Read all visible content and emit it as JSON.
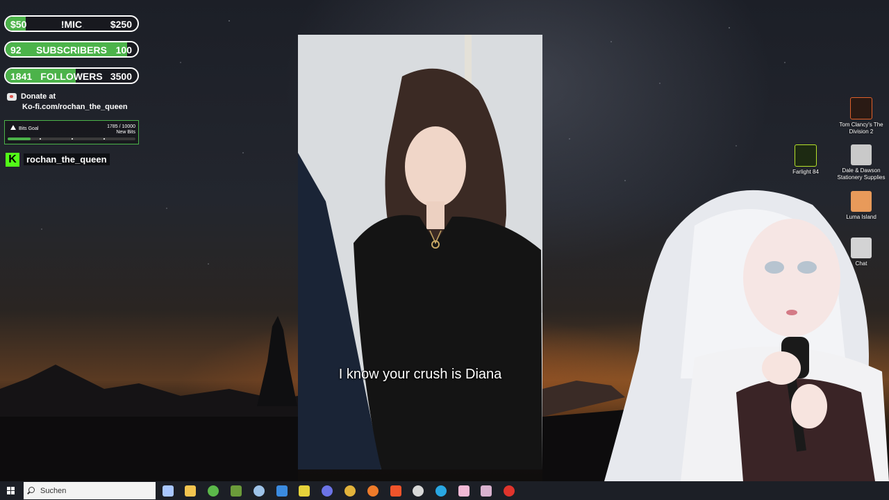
{
  "overlay": {
    "mic_goal": {
      "left": "$50",
      "center": "!MIC",
      "right": "$250",
      "progress": 0.15
    },
    "subscribers_goal": {
      "left": "92",
      "center": "SUBSCRIBERS",
      "right": "100",
      "progress": 0.92
    },
    "followers_goal": {
      "left": "1841",
      "center": "FOLLOWERS",
      "right": "3500",
      "progress": 0.53
    },
    "donate": {
      "line1": "Donate at",
      "line2": "Ko-fi.com/rochan_the_queen"
    },
    "bits_goal": {
      "title": "Bits Goal",
      "count": "1785 / 10000",
      "unit": "New Bits",
      "progress": 0.18
    },
    "kick": {
      "logo": "K",
      "username": "rochan_the_queen"
    }
  },
  "video": {
    "subtitle": "I know your crush is Diana"
  },
  "desktop_icons": [
    {
      "label": "Tom Clancy's The Division 2",
      "icon": "division2-icon",
      "color": "#e0602a"
    },
    {
      "label": "Farlight 84",
      "icon": "farlight-icon",
      "color": "#b7e32a"
    },
    {
      "label": "Dale & Dawson Stationery Supplies",
      "icon": "printer-icon",
      "color": "#c9c9c9"
    },
    {
      "label": "Luma Island",
      "icon": "luma-island-icon",
      "color": "#e89a5a"
    },
    {
      "label": "Chat",
      "icon": "chat-icon",
      "color": "#ffffff"
    }
  ],
  "taskbar": {
    "search_placeholder": "Suchen",
    "apps": [
      {
        "name": "task-view-icon",
        "color": "#a9c7ff"
      },
      {
        "name": "file-explorer-icon",
        "color": "#f3c44f"
      },
      {
        "name": "xbox-icon",
        "color": "#5bb84a"
      },
      {
        "name": "minecraft-icon",
        "color": "#6b9b3a"
      },
      {
        "name": "steam-icon",
        "color": "#9ec3e8"
      },
      {
        "name": "mail-icon",
        "color": "#3b8be0"
      },
      {
        "name": "g-hub-icon",
        "color": "#e5d23a"
      },
      {
        "name": "discord-icon",
        "color": "#6c74e6"
      },
      {
        "name": "chrome-icon",
        "color": "#e2b33b"
      },
      {
        "name": "firefox-icon",
        "color": "#ee7b2a"
      },
      {
        "name": "brave-icon",
        "color": "#f0542b"
      },
      {
        "name": "obs-icon",
        "color": "#d8d8d8"
      },
      {
        "name": "twinkle-icon",
        "color": "#29a7e3"
      },
      {
        "name": "vtube-studio-icon",
        "color": "#f2b9d6"
      },
      {
        "name": "pink-app-icon",
        "color": "#d9b2cf"
      },
      {
        "name": "opera-icon",
        "color": "#e0342c"
      }
    ]
  }
}
